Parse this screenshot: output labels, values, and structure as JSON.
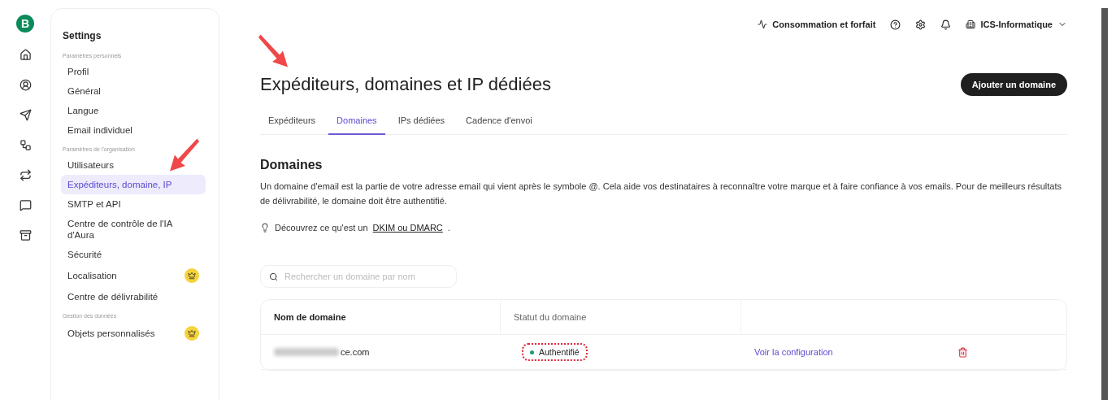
{
  "rail": {
    "logo": "B",
    "items": [
      {
        "kind": "home",
        "selected": false
      },
      {
        "kind": "contacts",
        "selected": false
      },
      {
        "kind": "send",
        "selected": false
      },
      {
        "kind": "flow",
        "selected": false
      },
      {
        "kind": "transfer",
        "selected": false
      },
      {
        "kind": "chat",
        "selected": false
      },
      {
        "kind": "box",
        "selected": false
      }
    ]
  },
  "sidebar": {
    "title": "Settings",
    "sections": [
      {
        "label": "Paramètres personnels",
        "items": [
          {
            "label": "Profil",
            "selected": false,
            "premium": false
          },
          {
            "label": "Général",
            "selected": false,
            "premium": false
          },
          {
            "label": "Langue",
            "selected": false,
            "premium": false
          },
          {
            "label": "Email individuel",
            "selected": false,
            "premium": false
          }
        ]
      },
      {
        "label": "Paramètres de l'organisation",
        "items": [
          {
            "label": "Utilisateurs",
            "selected": false,
            "premium": false
          },
          {
            "label": "Expéditeurs, domaine, IP",
            "selected": true,
            "premium": false
          },
          {
            "label": "SMTP et API",
            "selected": false,
            "premium": false
          },
          {
            "label": "Centre de contrôle de l'IA d'Aura",
            "selected": false,
            "premium": false
          },
          {
            "label": "Sécurité",
            "selected": false,
            "premium": false
          },
          {
            "label": "Localisation",
            "selected": false,
            "premium": true
          },
          {
            "label": "Centre de délivrabilité",
            "selected": false,
            "premium": false
          }
        ]
      },
      {
        "label": "Gestion des données",
        "items": [
          {
            "label": "Objets personnalisés",
            "selected": false,
            "premium": true
          }
        ]
      }
    ]
  },
  "topbar": {
    "usage": "Consommation et forfait",
    "account": "ICS-Informatique"
  },
  "page": {
    "title": "Expéditeurs, domaines et IP dédiées",
    "primary_button": "Ajouter un domaine",
    "tabs": [
      {
        "label": "Expéditeurs",
        "selected": false
      },
      {
        "label": "Domaines",
        "selected": true
      },
      {
        "label": "IPs dédiées",
        "selected": false
      },
      {
        "label": "Cadence d'envoi",
        "selected": false
      }
    ],
    "section_title": "Domaines",
    "description": "Un domaine d'email est la partie de votre adresse email qui vient après le symbole @. Cela aide vos destinataires à reconnaître votre marque et à faire confiance à vos emails. Pour de meilleurs résultats de délivrabilité, le domaine doit être authentifié.",
    "tip": {
      "text": "Découvrez ce qu'est un",
      "link": "DKIM ou DMARC",
      "suffix": "."
    },
    "search": {
      "placeholder": "Rechercher un domaine par nom"
    },
    "table": {
      "columns": [
        "Nom de domaine",
        "Statut du domaine"
      ],
      "rows": [
        {
          "domain": "ce.com",
          "status": "Authentifié",
          "authenticated": true,
          "action": "Voir la configuration"
        }
      ]
    }
  },
  "annotations": [
    {
      "kind": "arrow"
    },
    {
      "kind": "arrow"
    }
  ]
}
